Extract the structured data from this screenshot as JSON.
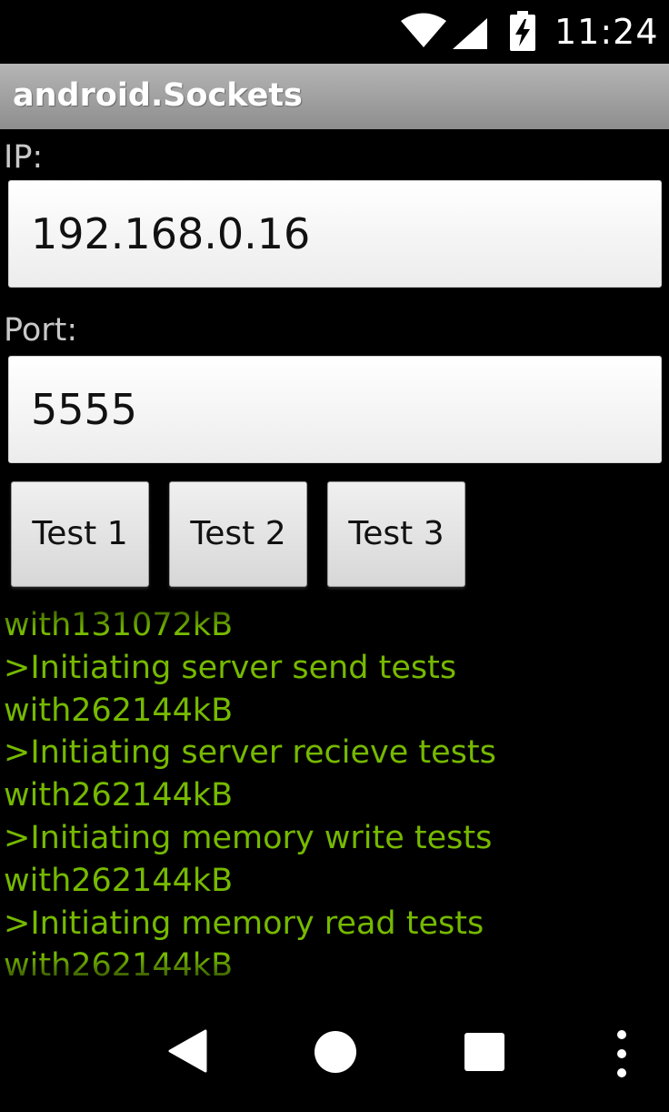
{
  "status_bar": {
    "time": "11:24",
    "icons": [
      "wifi-icon",
      "cell-signal-icon",
      "battery-charging-icon"
    ]
  },
  "action_bar": {
    "title": "android.Sockets"
  },
  "form": {
    "ip_label": "IP:",
    "ip_value": "192.168.0.16",
    "port_label": "Port:",
    "port_value": "5555"
  },
  "buttons": {
    "test1": "Test 1",
    "test2": "Test 2",
    "test3": "Test 3"
  },
  "log": {
    "color": "#76b900",
    "lines": [
      "with131072kB",
      ">Initiating server send tests",
      "with262144kB",
      ">Initiating server recieve tests",
      "with262144kB",
      ">Initiating memory write tests",
      "with262144kB",
      ">Initiating memory read tests",
      "with262144kB"
    ]
  },
  "nav_bar": {
    "icons": [
      "back-icon",
      "home-icon",
      "recents-icon",
      "overflow-menu-icon"
    ]
  }
}
